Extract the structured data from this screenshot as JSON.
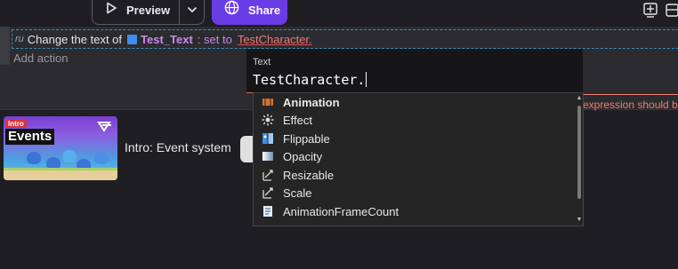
{
  "toolbar": {
    "preview_label": "Preview",
    "share_label": "Share",
    "icons": [
      "play-icon",
      "chevron-down-icon",
      "globe-icon",
      "add-scene-icon",
      "extension-icon"
    ]
  },
  "event": {
    "action_prefix": "Change the text of",
    "object_name": "Test_Text",
    "set_to": ": set to",
    "value": "TestCharacter.",
    "add_action": "Add action"
  },
  "editor": {
    "field_label": "Text",
    "field_value": "TestCharacter."
  },
  "error": {
    "text": "expression should b"
  },
  "suggestions": [
    {
      "label": "Animation",
      "icon": "animation-icon"
    },
    {
      "label": "Effect",
      "icon": "effect-icon"
    },
    {
      "label": "Flippable",
      "icon": "flippable-icon"
    },
    {
      "label": "Opacity",
      "icon": "opacity-icon"
    },
    {
      "label": "Resizable",
      "icon": "resizable-icon"
    },
    {
      "label": "Scale",
      "icon": "scale-icon"
    },
    {
      "label": "AnimationFrameCount",
      "icon": "script-icon"
    }
  ],
  "intro": {
    "badge": "Intro",
    "thumb_title": "Events",
    "title": "Intro: Event system"
  },
  "colors": {
    "share": "#6a3ce6",
    "object": "#c98be8",
    "error": "#f07d6e",
    "selection_border": "#3c8dbd"
  }
}
